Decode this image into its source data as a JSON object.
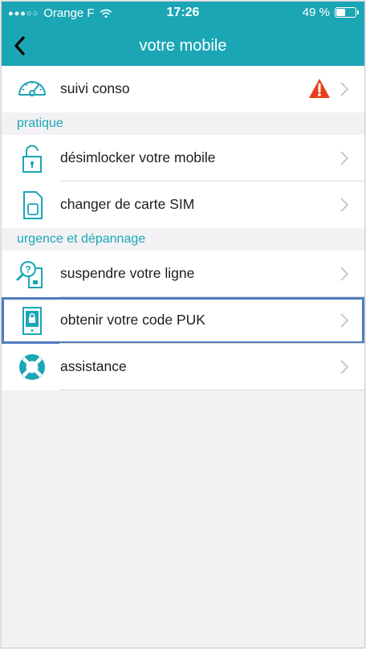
{
  "status_bar": {
    "carrier": "Orange F",
    "time": "17:26",
    "battery": "49 %",
    "battery_level": 0.49
  },
  "nav": {
    "title": "votre mobile"
  },
  "rows": [
    {
      "label": "suivi conso"
    },
    {
      "label": "désimlocker votre mobile"
    },
    {
      "label": "changer de carte SIM"
    },
    {
      "label": "suspendre votre ligne"
    },
    {
      "label": "obtenir votre code PUK"
    },
    {
      "label": "assistance"
    }
  ],
  "sections": {
    "pratique": "pratique",
    "urgence": "urgence et dépannage"
  },
  "colors": {
    "accent": "#1ba6b5",
    "warning": "#e8401c",
    "highlight": "#4f7bbf"
  }
}
